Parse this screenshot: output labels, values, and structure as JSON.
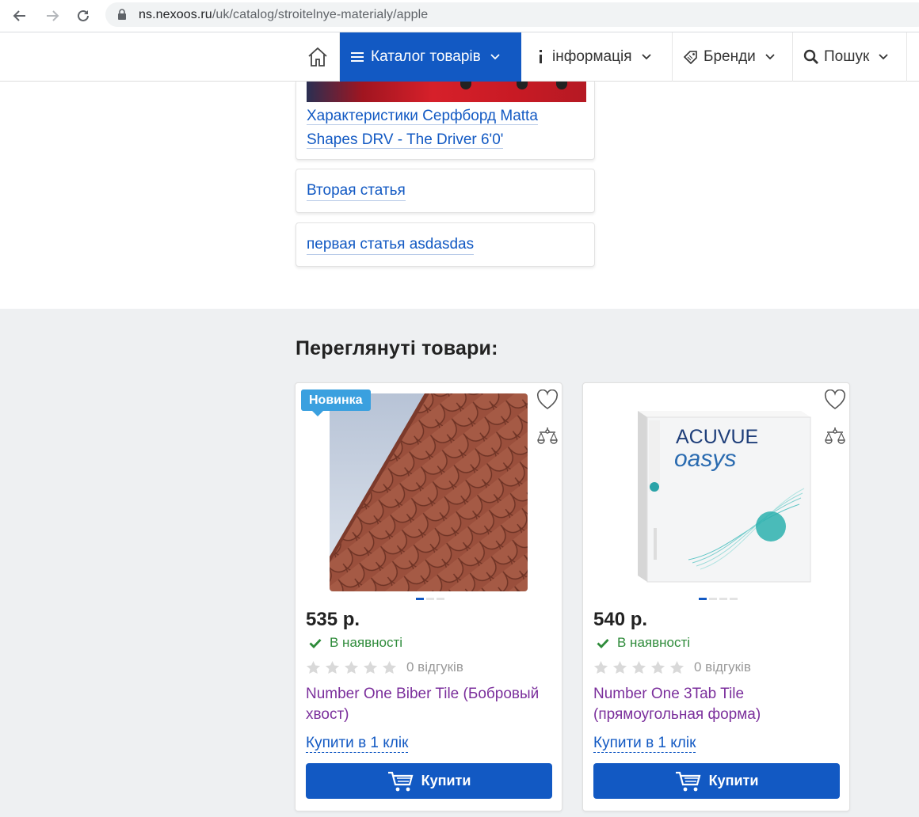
{
  "browser": {
    "url_host": "ns.nexoos.ru",
    "url_path": "/uk/catalog/stroitelnye-materialy/apple"
  },
  "nav": {
    "items": [
      {
        "label": "",
        "icon": "home-icon"
      },
      {
        "label": "Каталог товарів",
        "icon": "hamburger-icon"
      },
      {
        "label": "інформація",
        "icon": "info-icon"
      },
      {
        "label": "Бренди",
        "icon": "tag-icon"
      },
      {
        "label": "Пошук",
        "icon": "search-icon"
      }
    ]
  },
  "articles": [
    {
      "title": "Характеристики Серфборд Matta Shapes DRV - The Driver 6'0'"
    },
    {
      "title": "Вторая статья"
    },
    {
      "title": "первая статья asdasdas"
    }
  ],
  "viewed": {
    "title": "Переглянуті товари:",
    "products": [
      {
        "badge": "Новинка",
        "price": "535 р.",
        "stock": "В наявності",
        "rating_stars": 0,
        "reviews": "0 відгуків",
        "name": "Number One Biber Tile (Бобровый хвост)",
        "one_click": "Купити в 1 клік",
        "buy": "Купити",
        "image_slides": 3,
        "active_slide": 1
      },
      {
        "badge": "",
        "price": "540 р.",
        "stock": "В наявності",
        "rating_stars": 0,
        "reviews": "0 відгуків",
        "name": "Number One 3Tab Tile (прямоугольная форма)",
        "one_click": "Купити в 1 клік",
        "buy": "Купити",
        "image_slides": 4,
        "active_slide": 1,
        "image_text": {
          "brand_line1": "ACUVUE",
          "brand_line2": "oasys"
        }
      }
    ]
  },
  "colors": {
    "primary": "#1259c3",
    "badge": "#3aa0df",
    "stock": "#2e8b3a",
    "product_name": "#7b2f9c",
    "section_bg": "#eef0f2"
  }
}
